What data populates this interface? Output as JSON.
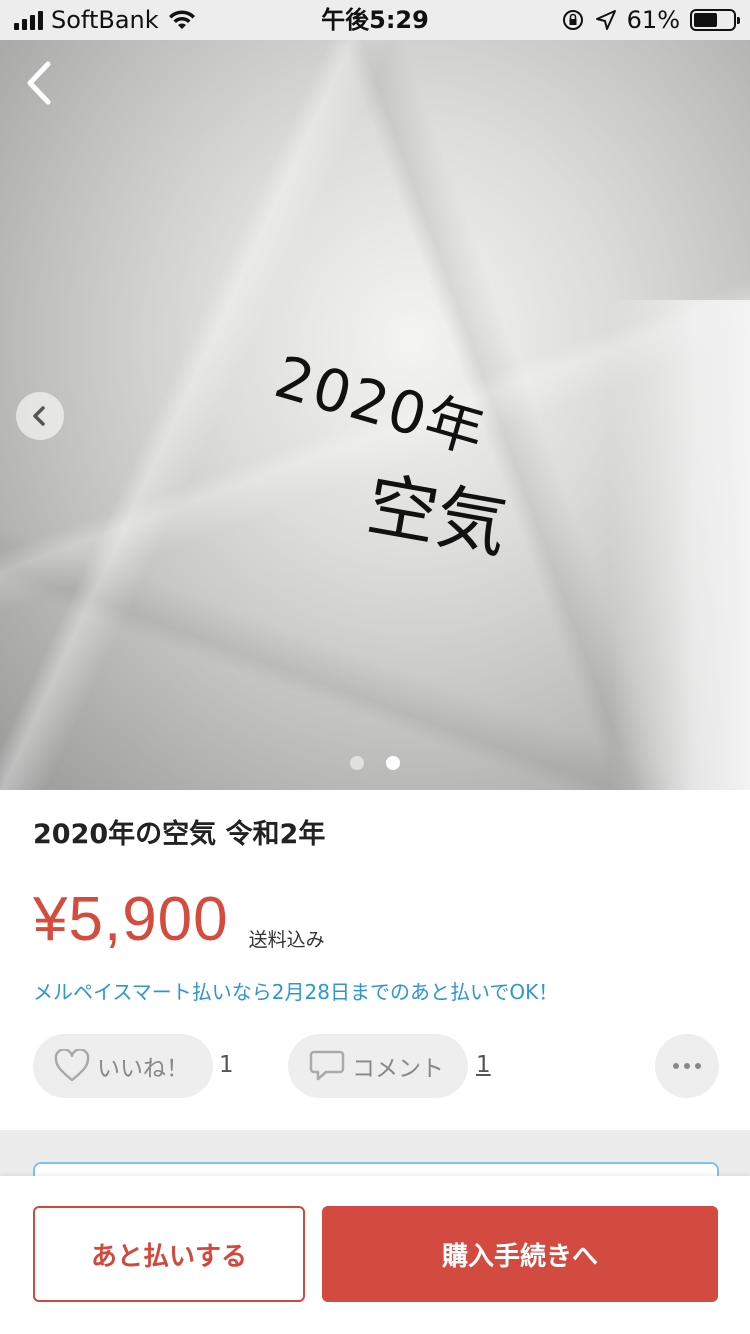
{
  "status_bar": {
    "carrier": "SoftBank",
    "time": "午後5:29",
    "battery": "61%",
    "battery_level": 0.61
  },
  "product_image": {
    "handwriting_line1": "2020年",
    "handwriting_line2": "空気",
    "image_count": 2,
    "active_index": 1
  },
  "product": {
    "title": "2020年の空気 令和2年",
    "price": "¥5,900",
    "shipping": "送料込み",
    "promo": "メルペイスマート払いなら2月28日までのあと払いでOK！"
  },
  "actions": {
    "like_label": "いいね！",
    "like_count": "1",
    "comment_label": "コメント",
    "comment_count": "1"
  },
  "bottom_bar": {
    "pay_later_label": "あと払いする",
    "buy_label": "購入手続きへ"
  },
  "colors": {
    "accent_red": "#d34b40",
    "link_blue": "#2d96d8"
  }
}
